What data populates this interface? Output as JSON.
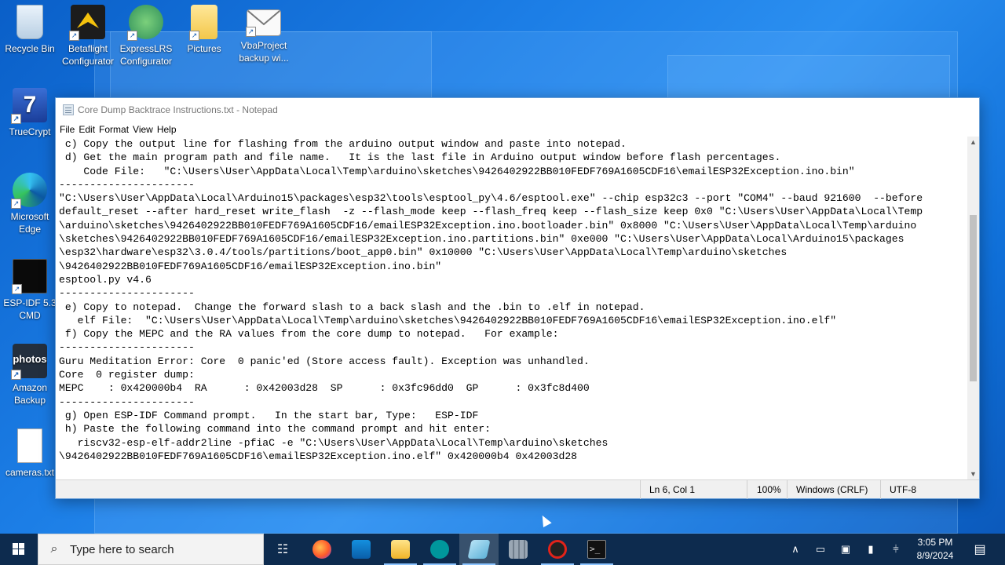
{
  "desktop": {
    "icons": [
      {
        "label": "Recycle Bin"
      },
      {
        "label": "Betaflight\nConfigurator"
      },
      {
        "label": "ExpressLRS\nConfigurator"
      },
      {
        "label": "Pictures"
      },
      {
        "label": "VbaProject\nbackup wi..."
      },
      {
        "label": "TrueCrypt"
      },
      {
        "label": "Microsoft\nEdge"
      },
      {
        "label": "ESP-IDF 5.3\nCMD"
      },
      {
        "label": "Amazon\nBackup"
      },
      {
        "label": "cameras.txt"
      }
    ],
    "amazon_logo_text": "photos"
  },
  "notepad": {
    "title": "Core Dump Backtrace Instructions.txt - Notepad",
    "menu": [
      "File",
      "Edit",
      "Format",
      "View",
      "Help"
    ],
    "content": " c) Copy the output line for flashing from the arduino output window and paste into notepad.\n d) Get the main program path and file name.   It is the last file in Arduino output window before flash percentages.\n    Code File:   \"C:\\Users\\User\\AppData\\Local\\Temp\\arduino\\sketches\\9426402922BB010FEDF769A1605CDF16\\emailESP32Exception.ino.bin\"\n----------------------\n\"C:\\Users\\User\\AppData\\Local\\Arduino15\\packages\\esp32\\tools\\esptool_py\\4.6/esptool.exe\" --chip esp32c3 --port \"COM4\" --baud 921600  --before\ndefault_reset --after hard_reset write_flash  -z --flash_mode keep --flash_freq keep --flash_size keep 0x0 \"C:\\Users\\User\\AppData\\Local\\Temp\n\\arduino\\sketches\\9426402922BB010FEDF769A1605CDF16/emailESP32Exception.ino.bootloader.bin\" 0x8000 \"C:\\Users\\User\\AppData\\Local\\Temp\\arduino\n\\sketches\\9426402922BB010FEDF769A1605CDF16/emailESP32Exception.ino.partitions.bin\" 0xe000 \"C:\\Users\\User\\AppData\\Local\\Arduino15\\packages\n\\esp32\\hardware\\esp32\\3.0.4/tools/partitions/boot_app0.bin\" 0x10000 \"C:\\Users\\User\\AppData\\Local\\Temp\\arduino\\sketches\n\\9426402922BB010FEDF769A1605CDF16/emailESP32Exception.ino.bin\"\nesptool.py v4.6\n----------------------\n e) Copy to notepad.  Change the forward slash to a back slash and the .bin to .elf in notepad.\n   elf File:  \"C:\\Users\\User\\AppData\\Local\\Temp\\arduino\\sketches\\9426402922BB010FEDF769A1605CDF16\\emailESP32Exception.ino.elf\"\n f) Copy the MEPC and the RA values from the core dump to notepad.   For example:\n----------------------\nGuru Meditation Error: Core  0 panic'ed (Store access fault). Exception was unhandled.\nCore  0 register dump:\nMEPC    : 0x420000b4  RA      : 0x42003d28  SP      : 0x3fc96dd0  GP      : 0x3fc8d400\n----------------------\n g) Open ESP-IDF Command prompt.   In the start bar, Type:   ESP-IDF\n h) Paste the following command into the command prompt and hit enter:\n   riscv32-esp-elf-addr2line -pfiaC -e \"C:\\Users\\User\\AppData\\Local\\Temp\\arduino\\sketches\n\\9426402922BB010FEDF769A1605CDF16\\emailESP32Exception.ino.elf\" 0x420000b4 0x42003d28",
    "status": {
      "position": "Ln 6, Col 1",
      "zoom": "100%",
      "line_ending": "Windows (CRLF)",
      "encoding": "UTF-8"
    }
  },
  "taskbar": {
    "search_placeholder": "Type here to search",
    "apps": [
      "task-view",
      "firefox",
      "outlook",
      "file-explorer",
      "arduino",
      "notepad",
      "calculator",
      "obs",
      "terminal"
    ],
    "time": "3:05 PM",
    "date": "8/9/2024"
  }
}
